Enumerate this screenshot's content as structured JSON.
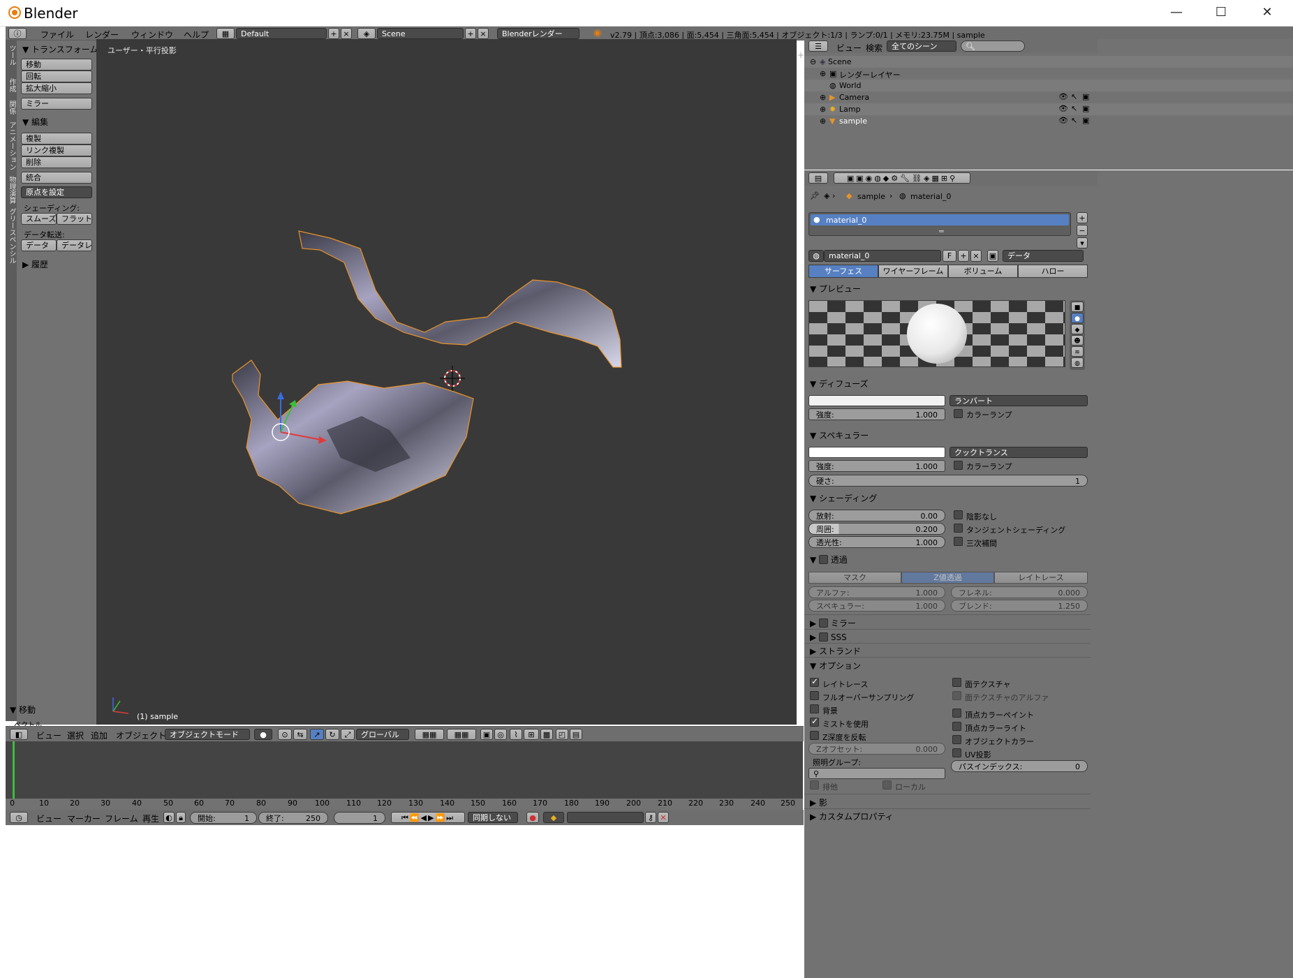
{
  "window": {
    "title": "Blender",
    "minimize": "—",
    "maximize": "☐",
    "close": "✕"
  },
  "info_header": {
    "menus": [
      "ファイル",
      "レンダー",
      "ウィンドウ",
      "ヘルプ"
    ],
    "layout": "Default",
    "scene": "Scene",
    "engine": "Blenderレンダー",
    "stats": "v2.79 | 頂点:3,086 | 面:5,454 | 三角面:5,454 | オブジェクト:1/3 | ランプ:0/1 | メモリ:23.75M | sample"
  },
  "tool_shelf": {
    "vertical_tabs": [
      "ツール",
      "作成",
      "関係",
      "アニメーション",
      "物理演算",
      "グリースペンシル"
    ],
    "transform_header": "トランスフォーム",
    "transform_buttons": [
      "移動",
      "回転",
      "拡大縮小"
    ],
    "mirror": "ミラー",
    "edit_header": "編集",
    "edit_buttons": [
      "複製",
      "リンク複製",
      "削除"
    ],
    "join": "統合",
    "set_origin": "原点を設定",
    "shading_label": "シェーディング:",
    "smooth": "スムーズ",
    "flat": "フラット",
    "data_transfer_label": "データ転送:",
    "data": "データ",
    "data_layout": "データレ",
    "history_header": "履歴",
    "operator_header": "移動",
    "operator_sub": "ベクトル"
  },
  "viewport": {
    "view_name": "ユーザー・平行投影",
    "object_label": "(1) sample",
    "accent_red": "#e03b3b",
    "accent_green": "#3bbf3b",
    "accent_blue": "#3b6be0",
    "outline_color": "#e8932a"
  },
  "view3d_header": {
    "menus": [
      "ビュー",
      "選択",
      "追加",
      "オブジェクト"
    ],
    "mode": "オブジェクトモード",
    "orientation": "グローバル"
  },
  "timeline": {
    "ticks": [
      "0",
      "10",
      "20",
      "30",
      "40",
      "50",
      "60",
      "70",
      "80",
      "90",
      "100",
      "110",
      "120",
      "130",
      "140",
      "150",
      "160",
      "170",
      "180",
      "190",
      "200",
      "210",
      "220",
      "230",
      "240",
      "250"
    ],
    "menus": [
      "ビュー",
      "マーカー",
      "フレーム",
      "再生"
    ],
    "start_label": "開始:",
    "start_value": "1",
    "end_label": "終了:",
    "end_value": "250",
    "current": "1",
    "sync": "同期しない"
  },
  "outliner": {
    "menus": [
      "ビュー",
      "検索"
    ],
    "filter": "全てのシーン",
    "items": [
      {
        "label": "Scene"
      },
      {
        "label": "レンダーレイヤー"
      },
      {
        "label": "World"
      },
      {
        "label": "Camera"
      },
      {
        "label": "Lamp"
      },
      {
        "label": "sample"
      }
    ]
  },
  "properties": {
    "breadcrumb_object": "sample",
    "breadcrumb_material": "material_0",
    "slot_name": "material_0",
    "material_name": "material_0",
    "fake_user": "F",
    "link": "データ",
    "tabs": [
      "サーフェス",
      "ワイヤーフレーム",
      "ボリューム",
      "ハロー"
    ],
    "preview_header": "プレビュー",
    "diffuse": {
      "header": "ディフューズ",
      "shader": "ランバート",
      "intensity_label": "強度:",
      "intensity": "1.000",
      "ramp": "カラーランプ"
    },
    "specular": {
      "header": "スペキュラー",
      "shader": "クックトランス",
      "intensity_label": "強度:",
      "intensity": "1.000",
      "ramp": "カラーランプ",
      "hardness_label": "硬さ:",
      "hardness": "1"
    },
    "shading": {
      "header": "シェーディング",
      "emit_label": "放射:",
      "emit": "0.00",
      "ambient_label": "周囲:",
      "ambient": "0.200",
      "translucency_label": "透光性:",
      "translucency": "1.000",
      "shadeless": "陰影なし",
      "tangent": "タンジェントシェーディング",
      "cubic": "三次補間"
    },
    "transparency": {
      "header": "透過",
      "modes": [
        "マスク",
        "Z値透過",
        "レイトレース"
      ],
      "alpha_label": "アルファ:",
      "alpha": "1.000",
      "fresnel_label": "フレネル:",
      "fresnel": "0.000",
      "specular_label": "スペキュラー:",
      "specular": "1.000",
      "blend_label": "ブレンド:",
      "blend": "1.250"
    },
    "mirror_header": "ミラー",
    "sss_header": "SSS",
    "strand_header": "ストランド",
    "options": {
      "header": "オプション",
      "left": [
        "レイトレース",
        "フルオーバーサンプリング",
        "背景",
        "ミストを使用",
        "Z深度を反転"
      ],
      "right": [
        "面テクスチャ",
        "面テクスチャのアルファ",
        "頂点カラーペイント",
        "頂点カラーライト",
        "オブジェクトカラー",
        "UV投影"
      ],
      "z_offset_label": "Zオフセット:",
      "z_offset": "0.000",
      "light_group_label": "照明グループ:",
      "pass_index_label": "パスインデックス:",
      "pass_index": "0",
      "exclusive": "排他",
      "local": "ローカル"
    },
    "shadow_header": "影",
    "custom_props_header": "カスタムプロパティ"
  }
}
